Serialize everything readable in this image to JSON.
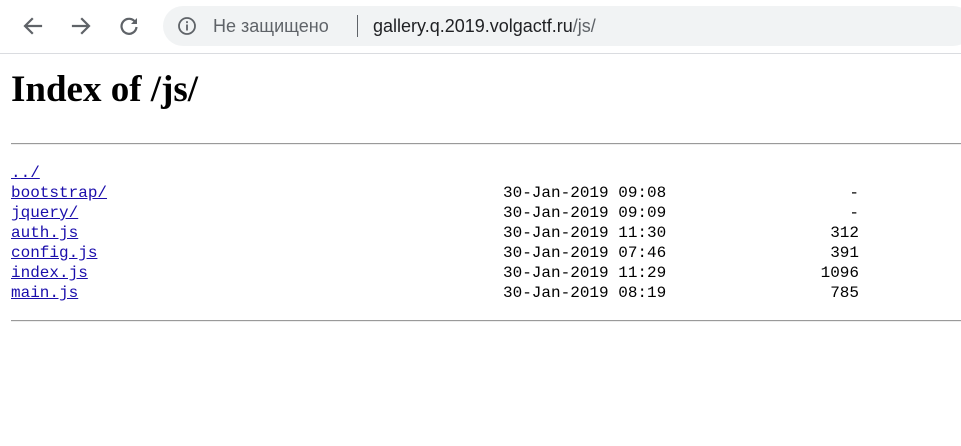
{
  "browser": {
    "security_label": "Не защищено",
    "url_host": "gallery.q.2019.volgactf.ru",
    "url_path": "/js/"
  },
  "page": {
    "heading": "Index of /js/",
    "entries": [
      {
        "name": "../",
        "date": "",
        "size": ""
      },
      {
        "name": "bootstrap/",
        "date": "30-Jan-2019 09:08",
        "size": "-"
      },
      {
        "name": "jquery/",
        "date": "30-Jan-2019 09:09",
        "size": "-"
      },
      {
        "name": "auth.js",
        "date": "30-Jan-2019 11:30",
        "size": "312"
      },
      {
        "name": "config.js",
        "date": "30-Jan-2019 07:46",
        "size": "391"
      },
      {
        "name": "index.js",
        "date": "30-Jan-2019 11:29",
        "size": "1096"
      },
      {
        "name": "main.js",
        "date": "30-Jan-2019 08:19",
        "size": "785"
      }
    ]
  },
  "icons": {
    "back": "back-arrow-icon",
    "forward": "forward-arrow-icon",
    "reload": "reload-icon",
    "info": "info-icon"
  },
  "colors": {
    "link": "#1a0dab",
    "omnibox_bg": "#f1f3f4"
  }
}
